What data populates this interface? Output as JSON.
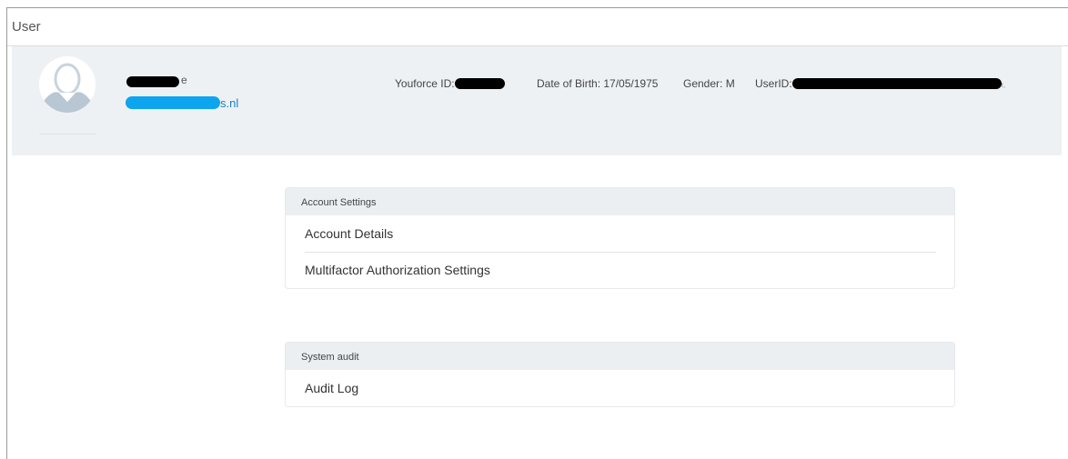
{
  "window": {
    "title": "User"
  },
  "profile": {
    "name_suffix": "e",
    "email_suffix": "s.nl",
    "youforce_id_label": "Youforce ID:",
    "dob_label": "Date of Birth:",
    "dob_value": "17/05/1975",
    "gender_label": "Gender:",
    "gender_value": "M",
    "userid_label": "UserID:",
    "userid_suffix": "r,"
  },
  "account_settings": {
    "header": "Account Settings",
    "items": [
      "Account Details",
      "Multifactor Authorization Settings"
    ]
  },
  "system_audit": {
    "header": "System audit",
    "items": [
      "Audit Log"
    ]
  },
  "colors": {
    "redaction_black": "#000000",
    "redaction_blue": "#0ea5ef",
    "email_link": "#1a80c4"
  }
}
